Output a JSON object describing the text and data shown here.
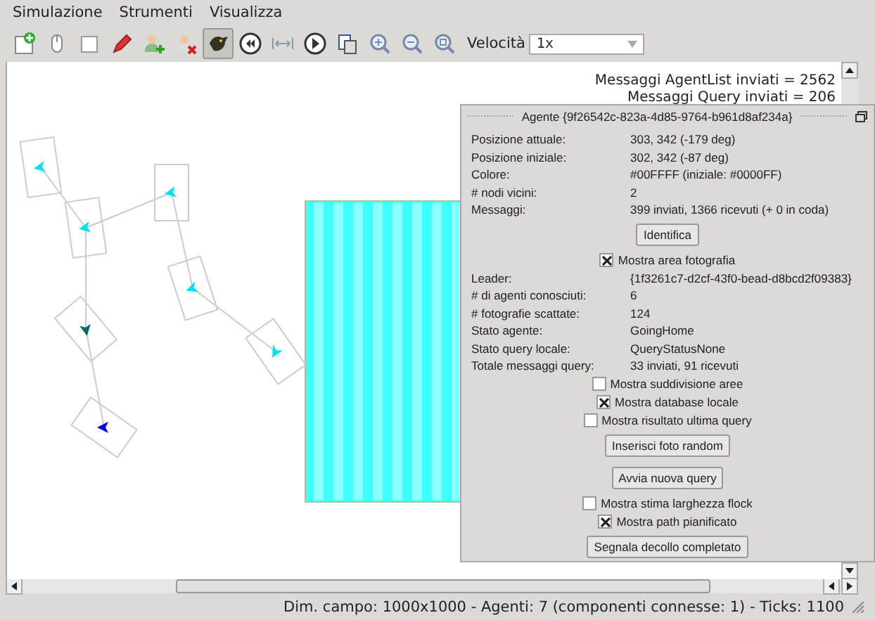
{
  "menu": [
    {
      "label": "Simulazione"
    },
    {
      "label": "Strumenti"
    },
    {
      "label": "Visualizza"
    }
  ],
  "toolbar": {
    "buttons": [
      {
        "pressed": false
      },
      {
        "pressed": false
      },
      {
        "pressed": false
      },
      {
        "pressed": false
      },
      {
        "pressed": false
      },
      {
        "pressed": false
      },
      {
        "pressed": true
      },
      {
        "pressed": false
      },
      {
        "pressed": false
      },
      {
        "pressed": false
      },
      {
        "pressed": false
      },
      {
        "pressed": false
      },
      {
        "pressed": false
      },
      {
        "pressed": false
      }
    ],
    "speed_label": "Velocità",
    "speed_value": "1x"
  },
  "overlay": [
    "Messaggi AgentList inviati = 2562",
    "Messaggi Query inviati = 206"
  ],
  "panel": {
    "title": "Agente {9f26542c-823a-4d85-9764-b961d8af234a}",
    "rows": [
      {
        "kind": "field",
        "label": "Posizione attuale:",
        "value": "303, 342 (-179 deg)"
      },
      {
        "kind": "field",
        "label": "Posizione iniziale:",
        "value": "302, 342 (-87 deg)"
      },
      {
        "kind": "field",
        "label": "Colore:",
        "value": "#00FFFF (iniziale: #0000FF)"
      },
      {
        "kind": "field",
        "label": "# nodi vicini:",
        "value": "2"
      },
      {
        "kind": "field",
        "label": "Messaggi:",
        "value": "399 inviati, 1366 ricevuti (+ 0 in coda)"
      },
      {
        "kind": "button",
        "label": "Identifica"
      },
      {
        "kind": "checkbox",
        "label": "Mostra area fotografia",
        "checked": true
      },
      {
        "kind": "field",
        "label": "Leader:",
        "value": "{1f3261c7-d2cf-43f0-bead-d8bcd2f09383}"
      },
      {
        "kind": "field",
        "label": "# di agenti conosciuti:",
        "value": "6"
      },
      {
        "kind": "field",
        "label": "# fotografie scattate:",
        "value": "124"
      },
      {
        "kind": "field",
        "label": "Stato agente:",
        "value": "GoingHome"
      },
      {
        "kind": "field",
        "label": "Stato query locale:",
        "value": "QueryStatusNone"
      },
      {
        "kind": "field",
        "label": "Totale messaggi query:",
        "value": "33 inviati, 91 ricevuti"
      },
      {
        "kind": "checkbox",
        "label": "Mostra suddivisione aree",
        "checked": false
      },
      {
        "kind": "checkbox",
        "label": "Mostra database locale",
        "checked": true
      },
      {
        "kind": "checkbox",
        "label": "Mostra risultato ultima query",
        "checked": false
      },
      {
        "kind": "button",
        "label": "Inserisci foto random"
      },
      {
        "kind": "button",
        "label": "Avvia nuova query"
      },
      {
        "kind": "checkbox",
        "label": "Mostra stima larghezza flock",
        "checked": false
      },
      {
        "kind": "checkbox",
        "label": "Mostra path pianificato",
        "checked": true
      },
      {
        "kind": "button",
        "label": "Segnala decollo completato"
      }
    ]
  },
  "status_bar": "Dim. campo: 1000x1000 - Agenti: 7 (componenti connesse: 1) - Ticks: 1100"
}
